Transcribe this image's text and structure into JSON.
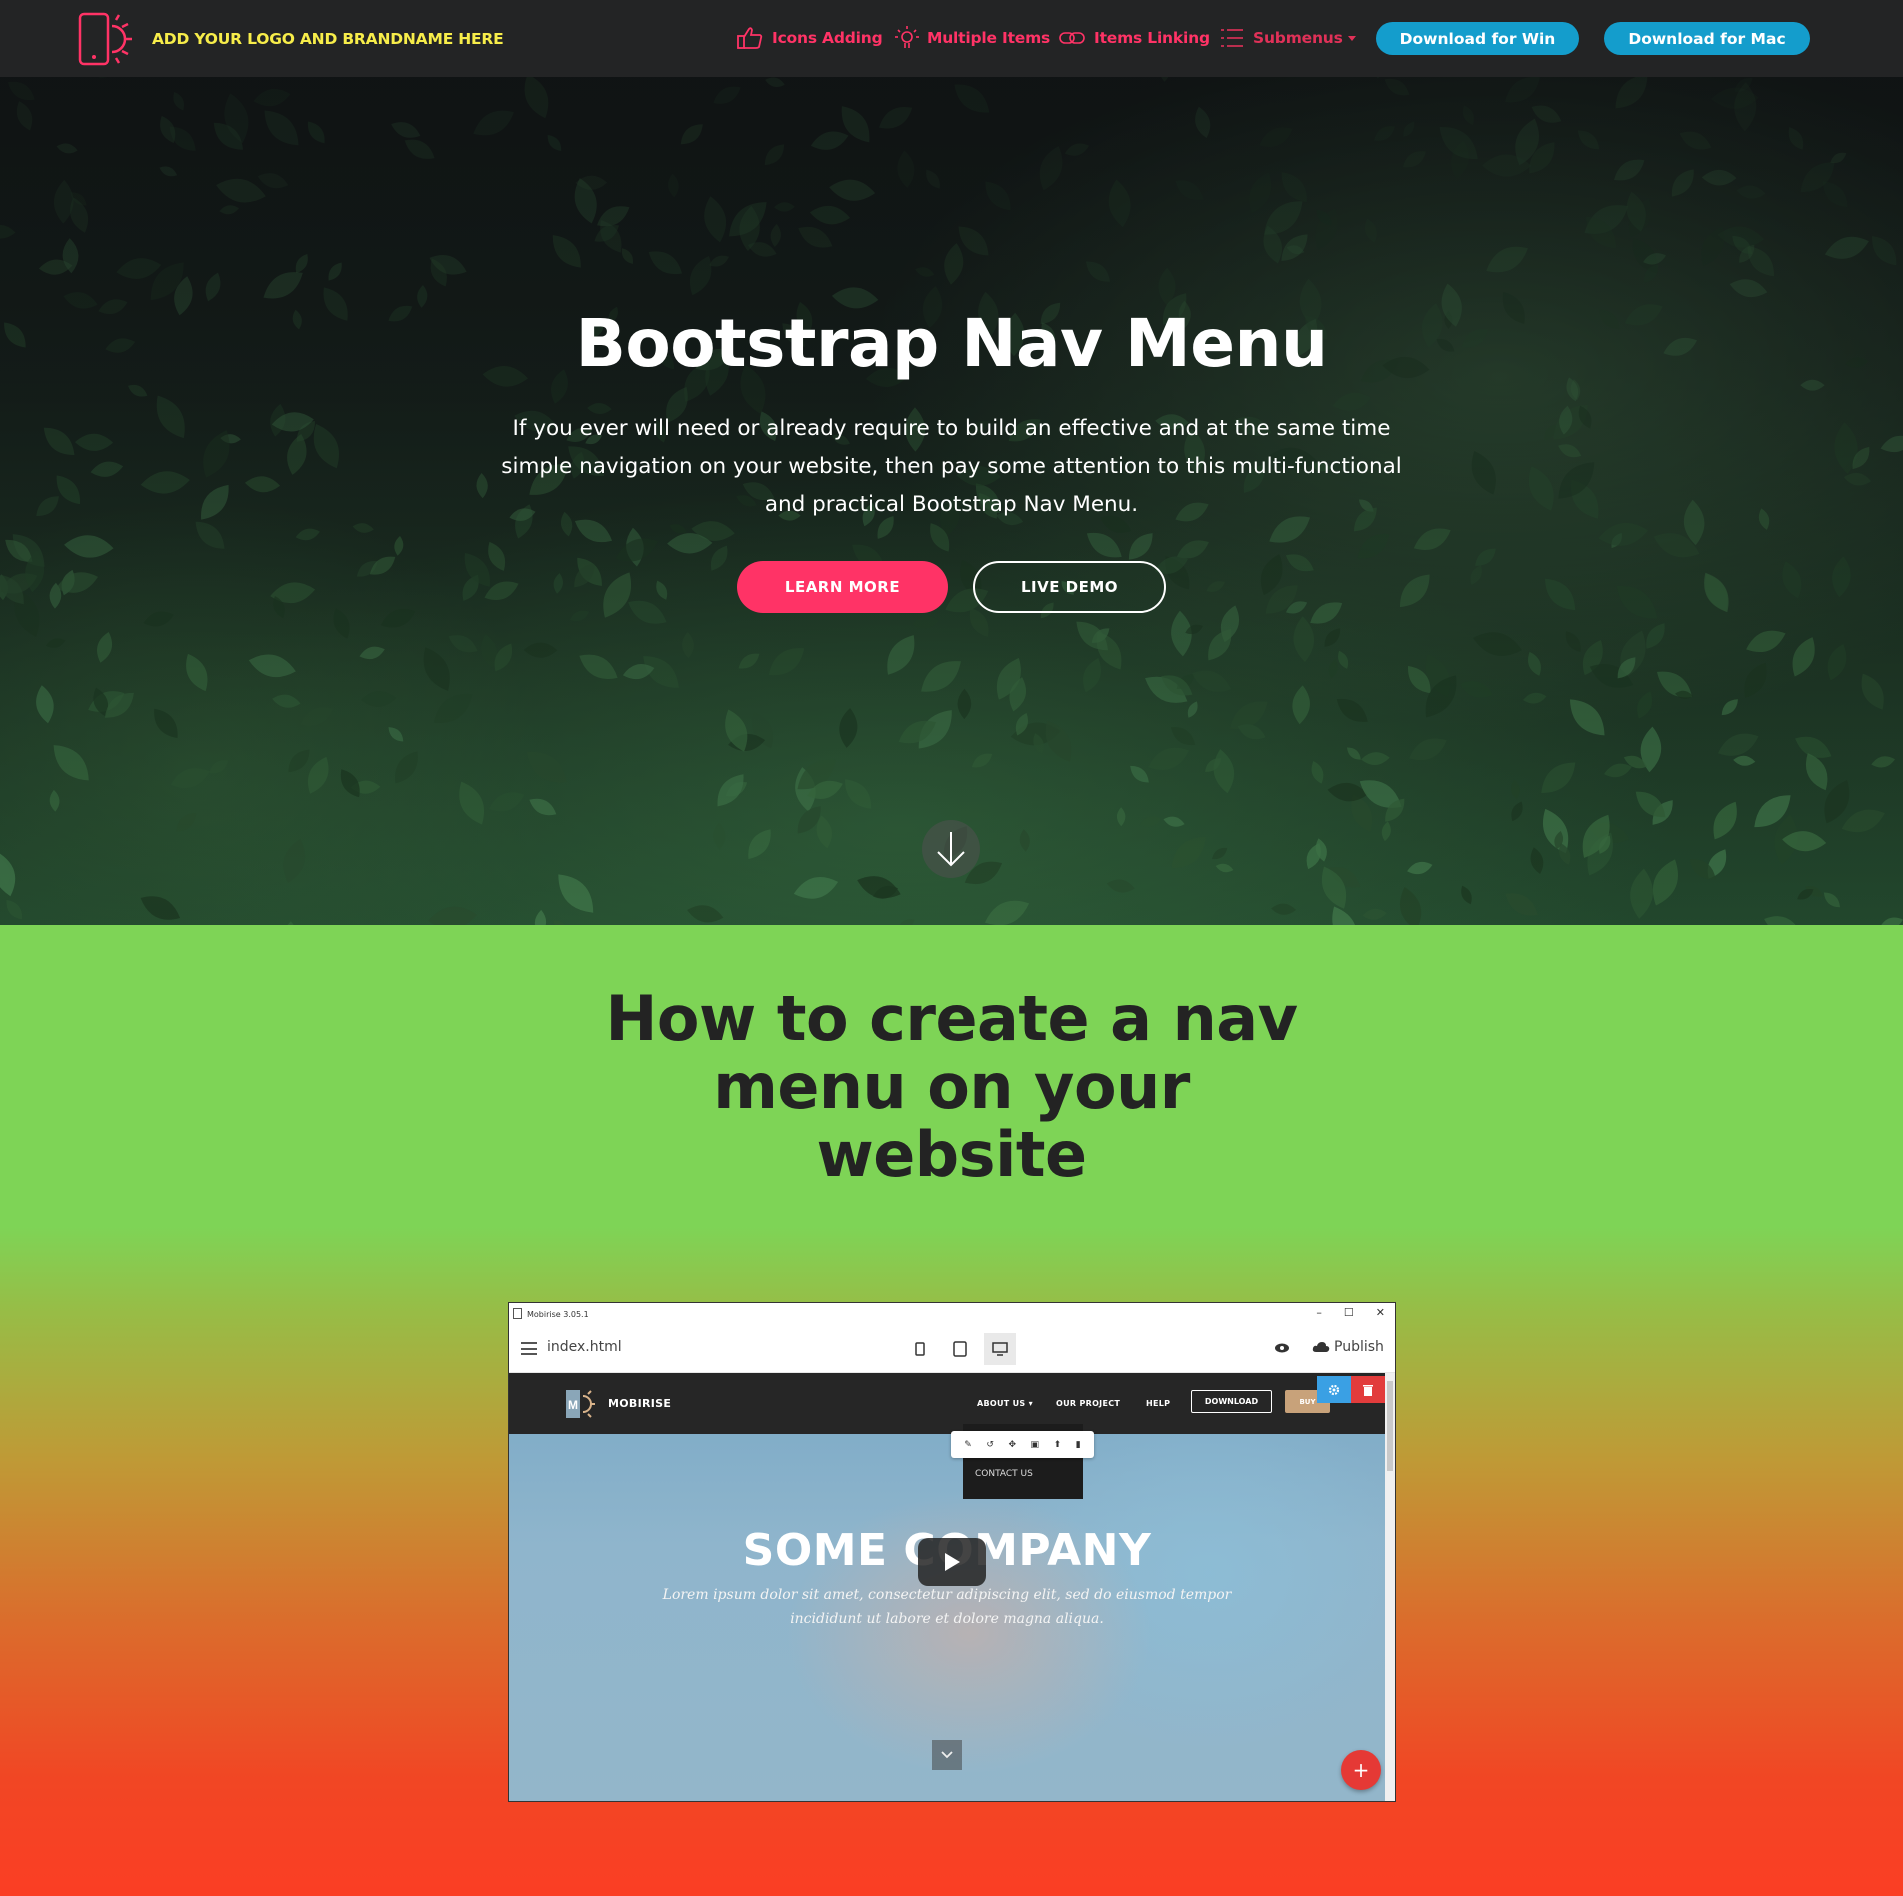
{
  "navbar": {
    "brand_name": "ADD YOUR LOGO AND BRANDNAME HERE",
    "items": [
      {
        "label": "Icons Adding",
        "icon": "thumbs-up-icon"
      },
      {
        "label": "Multiple Items",
        "icon": "lightbulb-icon"
      },
      {
        "label": "Items Linking",
        "icon": "link-icon"
      },
      {
        "label": "Submenus",
        "icon": "list-icon"
      }
    ],
    "download_win": "Download for Win",
    "download_mac": "Download for Mac",
    "colors": {
      "brand": "#f7ed4a",
      "link": "#ff3366",
      "button": "#149dcc"
    }
  },
  "hero": {
    "title": "Bootstrap Nav Menu",
    "text": "If you ever will need or already require to build an effective and at the same time simple navigation on your website, then pay some attention to this multi-functional and practical Bootstrap Nav Menu.",
    "learn_more": "LEARN MORE",
    "live_demo": "LIVE DEMO",
    "accent": "#ff3366"
  },
  "section2": {
    "title": "How to create a nav menu on your website"
  },
  "video": {
    "window_title": "Mobirise 3.05.1",
    "file_name": "index.html",
    "publish": "Publish",
    "site": {
      "brand": "MOBIRISE",
      "links": [
        "ABOUT US",
        "OUR PROJECT",
        "HELP"
      ],
      "download": "DOWNLOAD",
      "buy": "BUY",
      "dropdown_item": "CONTACT US",
      "hero_title": "SOME COMPANY",
      "hero_text": "Lorem ipsum dolor sit amet, consectetur adipiscing elit, sed do eiusmod tempor incididunt ut labore et dolore magna aliqua."
    }
  }
}
